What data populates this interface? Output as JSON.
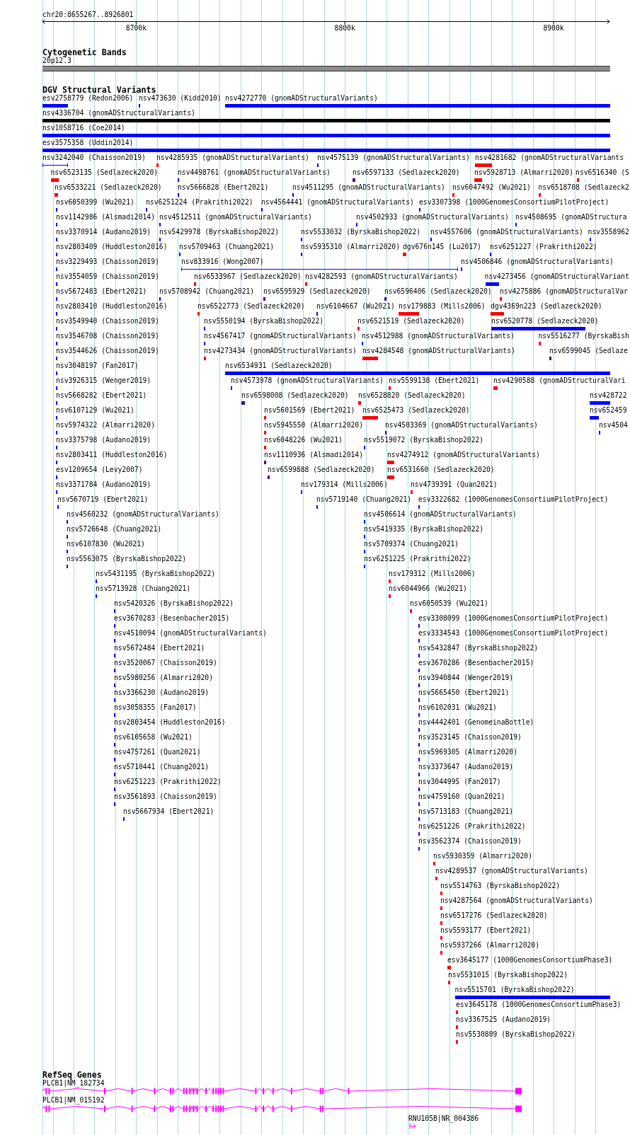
{
  "ruler": {
    "location": "chr20:8655267..8926801",
    "ticks": [
      "8700k",
      "8800k",
      "8900k"
    ]
  },
  "tracks": [
    {
      "kind": "cytoband",
      "title": "Cytogenetic Bands",
      "band": "20p12.3"
    },
    {
      "kind": "variants",
      "title": "DGV Structural Variants",
      "rows": [
        [
          {
            "label": "esv2758779 (Redon2006)",
            "color": "#0000ff",
            "kind": "block"
          },
          {
            "label": "nsv473630 (Kidd2010)",
            "color": "#0000ff",
            "kind": "block"
          },
          {
            "label": "nsv4272770 (gnomADStructuralVariants)",
            "color": "#0000ff",
            "kind": "block"
          }
        ],
        [
          {
            "label": "nsv4336704 (gnomADStructuralVariants)",
            "color": "#000000",
            "kind": "block"
          }
        ],
        [
          {
            "label": "nsv1058716 (Coe2014)",
            "color": "#0000ff",
            "kind": "block"
          }
        ],
        [
          {
            "label": "esv3575358 (Uddin2014)",
            "color": "#0000ff",
            "kind": "block"
          }
        ],
        [
          {
            "label": "nsv3242040 (Chaisson2019)",
            "color": "#0000ff",
            "kind": "span"
          },
          {
            "label": "nsv4285935 (gnomADStructuralVariants)",
            "color": "#ff0000",
            "kind": "block"
          },
          {
            "label": "nsv4575139 (gnomADStructuralVariants)",
            "color": "#0000ff",
            "kind": "block"
          },
          {
            "label": "nsv4281682 (gnomADStructuralVariants",
            "color": "#ff0000",
            "kind": "block"
          }
        ],
        [
          {
            "label": "nsv6523135 (Sedlazeck2020)",
            "color": "#ff0000",
            "kind": "block"
          },
          {
            "label": "nsv4498761 (gnomADStructuralVariants)",
            "color": "#0000ff",
            "kind": "block"
          },
          {
            "label": "nsv6597133 (Sedlazeck2020)",
            "color": "#4b0082",
            "kind": "block"
          },
          {
            "label": "nsv5928713 (Almarri2020)",
            "color": "#ff0000",
            "kind": "block"
          },
          {
            "label": "nsv6516340 (S",
            "color": "#ff0000",
            "kind": "block"
          }
        ],
        [
          {
            "label": "nsv6533221 (Sedlazeck2020)",
            "color": "#ff0000",
            "kind": "block"
          },
          {
            "label": "nsv5666828 (Ebert2021)",
            "color": "#0000ff",
            "kind": "block"
          },
          {
            "label": "nsv4511295 (gnomADStructuralVariants)",
            "color": "#0000ff",
            "kind": "block"
          },
          {
            "label": "nsv6047492 (Wu2021)",
            "color": "#ff0000",
            "kind": "block"
          },
          {
            "label": "nsv6518708 (Sedlazeck2",
            "color": "#ff0000",
            "kind": "block"
          }
        ],
        [
          {
            "label": "nsv6050399 (Wu2021)",
            "color": "#0000ff",
            "kind": "block"
          },
          {
            "label": "nsv6251224 (Prakrithi2022)",
            "color": "#0000ff",
            "kind": "block"
          },
          {
            "label": "nsv4564441 (gnomADStructuralVariants)",
            "color": "#0000ff",
            "kind": "block"
          },
          {
            "label": "esv3307398 (1000GenomesConsortiumPilotProject)",
            "color": "#0000ff",
            "kind": "block"
          }
        ],
        [
          {
            "label": "nsv1142986 (Alsmadi2014)",
            "color": "#0000ff",
            "kind": "block"
          },
          {
            "label": "nsv4512511 (gnomADStructuralVariants)",
            "color": "#0000ff",
            "kind": "block"
          },
          {
            "label": "nsv4502933 (gnomADStructuralVariants)",
            "color": "#0000ff",
            "kind": "block"
          },
          {
            "label": "nsv4508695 (gnomADStructura",
            "color": "#0000ff",
            "kind": "block"
          }
        ],
        [
          {
            "label": "nsv3370914 (Audano2019)",
            "color": "#0000ff",
            "kind": "block"
          },
          {
            "label": "nsv5429978 (ByrskaBishop2022)",
            "color": "#0000ff",
            "kind": "block"
          },
          {
            "label": "nsv5533032 (ByrskaBishop2022)",
            "color": "#0000ff",
            "kind": "block"
          },
          {
            "label": "nsv4557606 (gnomADStructuralVariants)",
            "color": "#0000ff",
            "kind": "block"
          },
          {
            "label": "nsv3558962",
            "color": "#0000ff",
            "kind": "block"
          }
        ],
        [
          {
            "label": "nsv2803409 (Huddleston2016)",
            "color": "#0000ff",
            "kind": "block"
          },
          {
            "label": "nsv5709463 (Chuang2021)",
            "color": "#0000ff",
            "kind": "block"
          },
          {
            "label": "nsv5935310 (Almarri2020)",
            "color": "#0000ff",
            "kind": "block"
          },
          {
            "label": "dgv676n145 (Lu2017)",
            "color": "#ff0000",
            "kind": "block"
          },
          {
            "label": "nsv6251227 (Prakrithi2022)",
            "color": "#0000ff",
            "kind": "block"
          }
        ],
        [
          {
            "label": "nsv3229493 (Chaisson2019)",
            "color": "#0000ff",
            "kind": "block"
          },
          {
            "label": "nsv833916 (Wong2007)",
            "color": "#0000ff",
            "kind": "span"
          },
          {
            "label": "nsv4506846 (gnomADStructuralVariants)",
            "color": "#0000ff",
            "kind": "block"
          }
        ],
        [
          {
            "label": "nsv3554059 (Chaisson2019)",
            "color": "#0000ff",
            "kind": "block"
          },
          {
            "label": "nsv6533967 (Sedlazeck2020)",
            "color": "#ff0000",
            "kind": "block"
          },
          {
            "label": "nsv4282593 (gnomADStructuralVariants)",
            "color": "#ff0000",
            "kind": "block"
          },
          {
            "label": "nsv4273456 (gnomADStructuralVariant",
            "color": "#0000ff",
            "kind": "block"
          }
        ],
        [
          {
            "label": "nsv5672483 (Ebert2021)",
            "color": "#0000ff",
            "kind": "block"
          },
          {
            "label": "nsv5708942 (Chuang2021)",
            "color": "#0000ff",
            "kind": "block"
          },
          {
            "label": "nsv6595929 (Sedlazeck2020)",
            "color": "#4b0082",
            "kind": "block"
          },
          {
            "label": "nsv6596406 (Sedlazeck2020)",
            "color": "#4b0082",
            "kind": "block"
          },
          {
            "label": "nsv4275886 (gnomADStructuralVar",
            "color": "#ff0000",
            "kind": "block"
          }
        ],
        [
          {
            "label": "nsv2803410 (Huddleston2016)",
            "color": "#0000ff",
            "kind": "block"
          },
          {
            "label": "nsv6522773 (Sedlazeck2020)",
            "color": "#ff0000",
            "kind": "block"
          },
          {
            "label": "nsv6104667 (Wu2021)",
            "color": "#0000ff",
            "kind": "block"
          },
          {
            "label": "nsv179883 (Mills2006)",
            "color": "#ff0000",
            "kind": "block"
          },
          {
            "label": "dgv4369n223 (Sedlazeck2020)",
            "color": "#ff0000",
            "kind": "block"
          }
        ],
        [
          {
            "label": "nsv3549940 (Chaisson2019)",
            "color": "#0000ff",
            "kind": "block"
          },
          {
            "label": "nsv5550194 (ByrskaBishop2022)",
            "color": "#0000ff",
            "kind": "block"
          },
          {
            "label": "nsv6521519 (Sedlazeck2020)",
            "color": "#ff0000",
            "kind": "block"
          },
          {
            "label": "nsv6520778 (Sedlazeck2020)",
            "color": "#0000ff",
            "kind": "block"
          }
        ],
        [
          {
            "label": "nsv3546708 (Chaisson2019)",
            "color": "#0000ff",
            "kind": "block"
          },
          {
            "label": "nsv4567417 (gnomADStructuralVariants)",
            "color": "#0000ff",
            "kind": "block"
          },
          {
            "label": "nsv4512988 (gnomADStructuralVariants)",
            "color": "#0000ff",
            "kind": "block"
          },
          {
            "label": "nsv5516277 (ByrskaBish",
            "color": "#ff0000",
            "kind": "block"
          }
        ],
        [
          {
            "label": "nsv3544626 (Chaisson2019)",
            "color": "#0000ff",
            "kind": "block"
          },
          {
            "label": "nsv4273434 (gnomADStructuralVariants)",
            "color": "#ff0000",
            "kind": "block"
          },
          {
            "label": "nsv4284548 (gnomADStructuralVariants)",
            "color": "#ff0000",
            "kind": "block"
          },
          {
            "label": "nsv6599045 (Sedlaze",
            "color": "#4b0082",
            "kind": "block"
          }
        ],
        [
          {
            "label": "nsv3048197 (Fan2017)",
            "color": "#0000ff",
            "kind": "block"
          },
          {
            "label": "nsv6534931 (Sedlazeck2020)",
            "color": "#0000ff",
            "kind": "block"
          }
        ],
        [
          {
            "label": "nsv3926315 (Wenger2019)",
            "color": "#0000ff",
            "kind": "block"
          },
          {
            "label": "nsv4573978 (gnomADStructuralVariants)",
            "color": "#0000ff",
            "kind": "block"
          },
          {
            "label": "nsv5599138 (Ebert2021)",
            "color": "#ff0000",
            "kind": "block"
          },
          {
            "label": "nsv4290588 (gnomADStructuralVari",
            "color": "#ff0000",
            "kind": "block"
          }
        ],
        [
          {
            "label": "nsv5668282 (Ebert2021)",
            "color": "#0000ff",
            "kind": "block"
          },
          {
            "label": "nsv6598008 (Sedlazeck2020)",
            "color": "#4b0082",
            "kind": "block"
          },
          {
            "label": "nsv6528820 (Sedlazeck2020)",
            "color": "#ff0000",
            "kind": "block"
          },
          {
            "label": "nsv428722",
            "color": "#0000ff",
            "kind": "block"
          }
        ],
        [
          {
            "label": "nsv6107129 (Wu2021)",
            "color": "#0000ff",
            "kind": "block"
          },
          {
            "label": "nsv5601569 (Ebert2021)",
            "color": "#ff0000",
            "kind": "block"
          },
          {
            "label": "nsv6525473 (Sedlazeck2020)",
            "color": "#ff0000",
            "kind": "block"
          },
          {
            "label": "nsv652459",
            "color": "#0000ff",
            "kind": "block"
          }
        ],
        [
          {
            "label": "nsv5974322 (Almarri2020)",
            "color": "#0000ff",
            "kind": "block"
          },
          {
            "label": "nsv5945550 (Almarri2020)",
            "color": "#ff0000",
            "kind": "block"
          },
          {
            "label": "nsv4503369 (gnomADStructuralVariants)",
            "color": "#0000ff",
            "kind": "block"
          },
          {
            "label": "nsv4504",
            "color": "#0000ff",
            "kind": "block"
          }
        ],
        [
          {
            "label": "nsv3375798 (Audano2019)",
            "color": "#0000ff",
            "kind": "block"
          },
          {
            "label": "nsv6048226 (Wu2021)",
            "color": "#ff0000",
            "kind": "block"
          },
          {
            "label": "nsv5519072 (ByrskaBishop2022)",
            "color": "#0000ff",
            "kind": "block"
          }
        ],
        [
          {
            "label": "nsv2803411 (Huddleston2016)",
            "color": "#0000ff",
            "kind": "block"
          },
          {
            "label": "nsv1110936 (Alsmadi2014)",
            "color": "#4b0082",
            "kind": "block"
          },
          {
            "label": "nsv4274912 (gnomADStructuralVariants)",
            "color": "#ff0000",
            "kind": "block"
          }
        ],
        [
          {
            "label": "esv1209654 (Levy2007)",
            "color": "#0000ff",
            "kind": "block"
          },
          {
            "label": "nsv6599888 (Sedlazeck2020)",
            "color": "#4b0082",
            "kind": "block"
          },
          {
            "label": "nsv6531660 (Sedlazeck2020)",
            "color": "#ff0000",
            "kind": "block"
          }
        ],
        [
          {
            "label": "nsv3371784 (Audano2019)",
            "color": "#0000ff",
            "kind": "block"
          },
          {
            "label": "nsv179314 (Mills2006)",
            "color": "#0000ff",
            "kind": "block"
          },
          {
            "label": "nsv4739391 (Quan2021)",
            "color": "#ff0000",
            "kind": "block"
          }
        ],
        [
          {
            "label": "nsv5670719 (Ebert2021)",
            "color": "#0000ff",
            "kind": "block"
          },
          {
            "label": "nsv5719140 (Chuang2021)",
            "color": "#0000ff",
            "kind": "block"
          },
          {
            "label": "esv3322682 (1000GenomesConsortiumPilotProject)",
            "color": "#0000ff",
            "kind": "block"
          }
        ],
        [
          {
            "label": "nsv4560232 (gnomADStructuralVariants)",
            "color": "#0000ff",
            "kind": "block"
          },
          {
            "label": "nsv4506614 (gnomADStructuralVariants)",
            "color": "#0000ff",
            "kind": "block"
          }
        ],
        [
          {
            "label": "nsv5726648 (Chuang2021)",
            "color": "#0000ff",
            "kind": "block"
          },
          {
            "label": "nsv5419335 (ByrskaBishop2022)",
            "color": "#0000ff",
            "kind": "block"
          }
        ],
        [
          {
            "label": "nsv6107830 (Wu2021)",
            "color": "#0000ff",
            "kind": "block"
          },
          {
            "label": "nsv5709374 (Chuang2021)",
            "color": "#0000ff",
            "kind": "block"
          }
        ],
        [
          {
            "label": "nsv5563075 (ByrskaBishop2022)",
            "color": "#0000ff",
            "kind": "block"
          },
          {
            "label": "nsv6251225 (Prakrithi2022)",
            "color": "#0000ff",
            "kind": "block"
          }
        ],
        [
          {
            "label": "nsv5431195 (ByrskaBishop2022)",
            "color": "#0000ff",
            "kind": "block"
          },
          {
            "label": "nsv179312 (Mills2006)",
            "color": "#ff0000",
            "kind": "block"
          }
        ],
        [
          {
            "label": "nsv5713928 (Chuang2021)",
            "color": "#0000ff",
            "kind": "block"
          },
          {
            "label": "nsv6044966 (Wu2021)",
            "color": "#ff0000",
            "kind": "block"
          }
        ],
        [
          {
            "label": "nsv5420326 (ByrskaBishop2022)",
            "color": "#0000ff",
            "kind": "block"
          },
          {
            "label": "nsv6050539 (Wu2021)",
            "color": "#ff0000",
            "kind": "block"
          }
        ],
        [
          {
            "label": "esv3670283 (Besenbacher2015)",
            "color": "#0000ff",
            "kind": "block"
          },
          {
            "label": "esv3308099 (1000GenomesConsortiumPilotProject)",
            "color": "#0000ff",
            "kind": "block"
          }
        ],
        [
          {
            "label": "nsv4510094 (gnomADStructuralVariants)",
            "color": "#0000ff",
            "kind": "block"
          },
          {
            "label": "esv3334543 (1000GenomesConsortiumPilotProject)",
            "color": "#0000ff",
            "kind": "block"
          }
        ],
        [
          {
            "label": "nsv5672484 (Ebert2021)",
            "color": "#0000ff",
            "kind": "block"
          },
          {
            "label": "nsv5432847 (ByrskaBishop2022)",
            "color": "#0000ff",
            "kind": "block"
          }
        ],
        [
          {
            "label": "nsv3520067 (Chaisson2019)",
            "color": "#0000ff",
            "kind": "block"
          },
          {
            "label": "esv3670286 (Besenbacher2015)",
            "color": "#0000ff",
            "kind": "block"
          }
        ],
        [
          {
            "label": "nsv5980256 (Almarri2020)",
            "color": "#0000ff",
            "kind": "block"
          },
          {
            "label": "nsv3940844 (Wenger2019)",
            "color": "#0000ff",
            "kind": "block"
          }
        ],
        [
          {
            "label": "nsv3366230 (Audano2019)",
            "color": "#0000ff",
            "kind": "block"
          },
          {
            "label": "nsv5665450 (Ebert2021)",
            "color": "#0000ff",
            "kind": "block"
          }
        ],
        [
          {
            "label": "nsv3058355 (Fan2017)",
            "color": "#0000ff",
            "kind": "block"
          },
          {
            "label": "nsv6102031 (Wu2021)",
            "color": "#0000ff",
            "kind": "block"
          }
        ],
        [
          {
            "label": "nsv2803454 (Huddleston2016)",
            "color": "#0000ff",
            "kind": "block"
          },
          {
            "label": "nsv4442401 (GenomeinaBottle)",
            "color": "#0000ff",
            "kind": "block"
          }
        ],
        [
          {
            "label": "nsv6105658 (Wu2021)",
            "color": "#0000ff",
            "kind": "block"
          },
          {
            "label": "nsv3523145 (Chaisson2019)",
            "color": "#0000ff",
            "kind": "block"
          }
        ],
        [
          {
            "label": "nsv4757261 (Quan2021)",
            "color": "#0000ff",
            "kind": "block"
          },
          {
            "label": "nsv5969305 (Almarri2020)",
            "color": "#0000ff",
            "kind": "block"
          }
        ],
        [
          {
            "label": "nsv5710441 (Chuang2021)",
            "color": "#0000ff",
            "kind": "block"
          },
          {
            "label": "nsv3373647 (Audano2019)",
            "color": "#0000ff",
            "kind": "block"
          }
        ],
        [
          {
            "label": "nsv6251223 (Prakrithi2022)",
            "color": "#0000ff",
            "kind": "block"
          },
          {
            "label": "nsv3044995 (Fan2017)",
            "color": "#0000ff",
            "kind": "block"
          }
        ],
        [
          {
            "label": "nsv3561893 (Chaisson2019)",
            "color": "#0000ff",
            "kind": "block"
          },
          {
            "label": "nsv4759160 (Quan2021)",
            "color": "#0000ff",
            "kind": "block"
          }
        ],
        [
          {
            "label": "nsv5667934 (Ebert2021)",
            "color": "#0000ff",
            "kind": "block"
          },
          {
            "label": "nsv5713183 (Chuang2021)",
            "color": "#0000ff",
            "kind": "block"
          }
        ],
        [
          {
            "label": "nsv6251226 (Prakrithi2022)",
            "color": "#0000ff",
            "kind": "block"
          }
        ],
        [
          {
            "label": "nsv3562374 (Chaisson2019)",
            "color": "#0000ff",
            "kind": "block"
          }
        ],
        [
          {
            "label": "nsv5930359 (Almarri2020)",
            "color": "#ff0000",
            "kind": "block"
          }
        ],
        [
          {
            "label": "nsv4289537 (gnomADStructuralVariants)",
            "color": "#ff0000",
            "kind": "block"
          }
        ],
        [
          {
            "label": "nsv5514763 (ByrskaBishop2022)",
            "color": "#ff0000",
            "kind": "block"
          }
        ],
        [
          {
            "label": "nsv4287564 (gnomADStructuralVariants)",
            "color": "#ff0000",
            "kind": "block"
          }
        ],
        [
          {
            "label": "nsv6517276 (Sedlazeck2020)",
            "color": "#ff0000",
            "kind": "block"
          }
        ],
        [
          {
            "label": "nsv5593177 (Ebert2021)",
            "color": "#ff0000",
            "kind": "block"
          }
        ],
        [
          {
            "label": "nsv5937266 (Almarri2020)",
            "color": "#ff0000",
            "kind": "block"
          }
        ],
        [
          {
            "label": "esv3645177 (1000GenomesConsortiumPhase3)",
            "color": "#ff0000",
            "kind": "block"
          }
        ],
        [
          {
            "label": "nsv5531015 (ByrskaBishop2022)",
            "color": "#ff0000",
            "kind": "block"
          }
        ],
        [
          {
            "label": "nsv5515701 (ByrskaBishop2022)",
            "color": "#0000ff",
            "kind": "block"
          }
        ],
        [
          {
            "label": "esv3645178 (1000GenomesConsortiumPhase3)",
            "color": "#ff0000",
            "kind": "block"
          }
        ],
        [
          {
            "label": "nsv3367525 (Audano2019)",
            "color": "#ff0000",
            "kind": "block"
          }
        ],
        [
          {
            "label": "nsv5530809 (ByrskaBishop2022)",
            "color": "#ff0000",
            "kind": "block"
          }
        ]
      ]
    },
    {
      "kind": "genes",
      "title": "RefSeq Genes",
      "genes": [
        {
          "label": "PLCB1|NM_182734",
          "kind": "spliced"
        },
        {
          "label": "PLCB1|NM_015192",
          "kind": "spliced"
        },
        {
          "label": "RNU105B|NR_004386",
          "kind": "marker"
        }
      ]
    }
  ]
}
